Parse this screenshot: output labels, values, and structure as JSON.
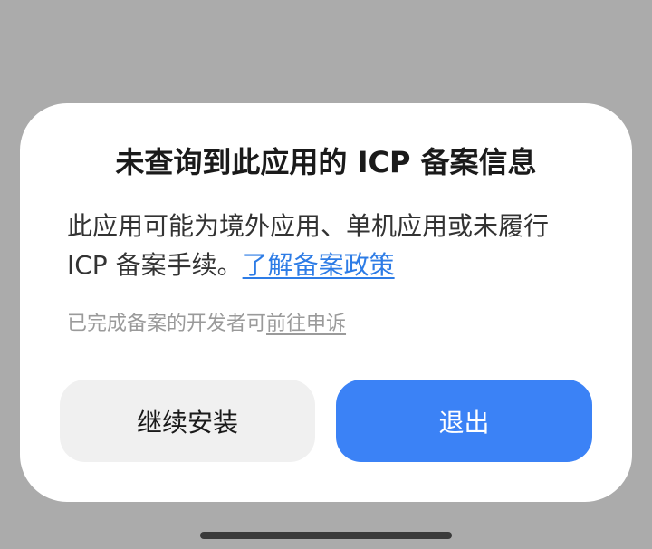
{
  "dialog": {
    "title": "未查询到此应用的 ICP 备案信息",
    "body_text": "此应用可能为境外应用、单机应用或未履行 ICP 备案手续。",
    "policy_link": "了解备案政策",
    "appeal_prefix": "已完成备案的开发者可",
    "appeal_link": "前往申诉",
    "continue_label": "继续安装",
    "exit_label": "退出"
  },
  "colors": {
    "overlay": "#ababab",
    "link": "#2d7ce6",
    "primary_button": "#3b82f6",
    "secondary_button": "#f0f0f0"
  }
}
